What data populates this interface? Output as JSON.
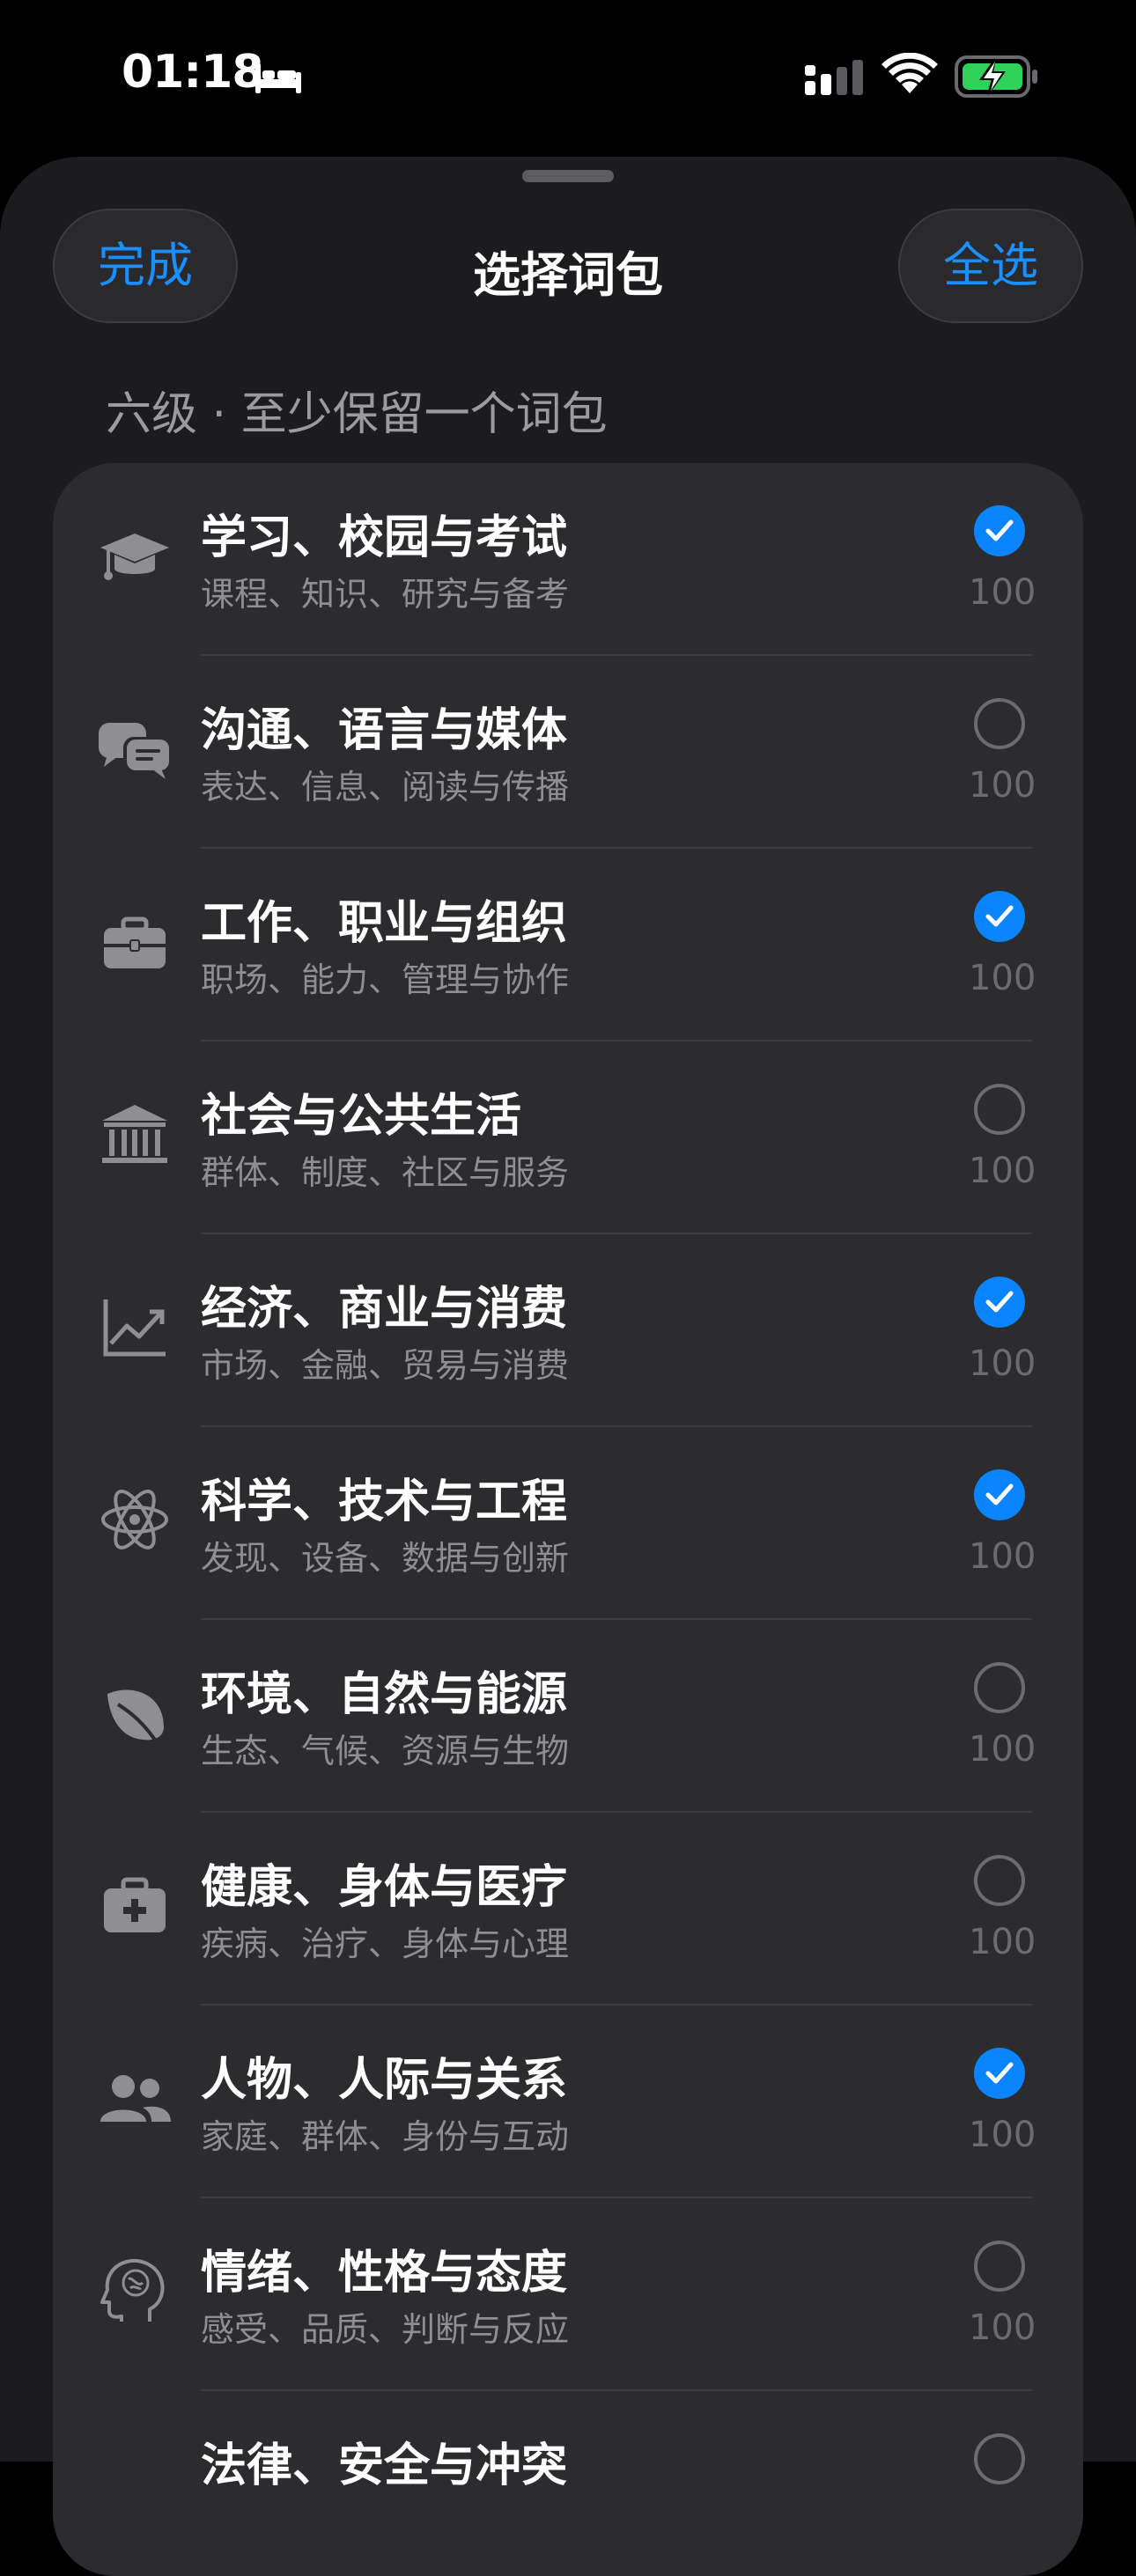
{
  "status_bar": {
    "time": "01:18",
    "icons": [
      "bed-icon",
      "cellular-signal-icon",
      "wifi-icon",
      "battery-charging-icon"
    ]
  },
  "nav": {
    "done_label": "完成",
    "title": "选择词包",
    "select_all_label": "全选"
  },
  "section_caption": "六级 · 至少保留一个词包",
  "accent_color": "#0a84ff",
  "packs": [
    {
      "title": "学习、校园与考试",
      "subtitle": "课程、知识、研究与备考",
      "count": "100",
      "checked": true,
      "icon": "graduation-cap-icon"
    },
    {
      "title": "沟通、语言与媒体",
      "subtitle": "表达、信息、阅读与传播",
      "count": "100",
      "checked": false,
      "icon": "chat-bubbles-icon"
    },
    {
      "title": "工作、职业与组织",
      "subtitle": "职场、能力、管理与协作",
      "count": "100",
      "checked": true,
      "icon": "briefcase-icon"
    },
    {
      "title": "社会与公共生活",
      "subtitle": "群体、制度、社区与服务",
      "count": "100",
      "checked": false,
      "icon": "institution-building-icon"
    },
    {
      "title": "经济、商业与消费",
      "subtitle": "市场、金融、贸易与消费",
      "count": "100",
      "checked": true,
      "icon": "trend-chart-icon"
    },
    {
      "title": "科学、技术与工程",
      "subtitle": "发现、设备、数据与创新",
      "count": "100",
      "checked": true,
      "icon": "atom-icon"
    },
    {
      "title": "环境、自然与能源",
      "subtitle": "生态、气候、资源与生物",
      "count": "100",
      "checked": false,
      "icon": "leaf-icon"
    },
    {
      "title": "健康、身体与医疗",
      "subtitle": "疾病、治疗、身体与心理",
      "count": "100",
      "checked": false,
      "icon": "medical-kit-icon"
    },
    {
      "title": "人物、人际与关系",
      "subtitle": "家庭、群体、身份与互动",
      "count": "100",
      "checked": true,
      "icon": "people-icon"
    },
    {
      "title": "情绪、性格与态度",
      "subtitle": "感受、品质、判断与反应",
      "count": "100",
      "checked": false,
      "icon": "head-brain-icon"
    },
    {
      "title": "法律、安全与冲突",
      "subtitle": "",
      "count": "",
      "checked": false,
      "icon": ""
    }
  ]
}
